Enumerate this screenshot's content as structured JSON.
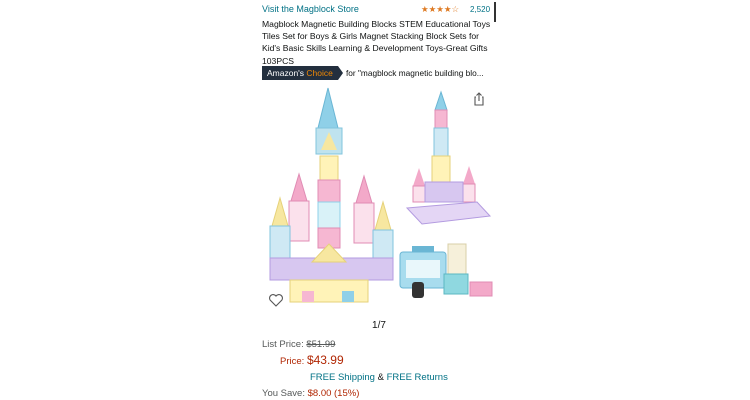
{
  "store": {
    "link": "Visit the Magblock Store",
    "stars_glyph": "★★★★☆",
    "rating_value": 4.5,
    "rating_count": "2,520"
  },
  "product": {
    "title": "Magblock Magnetic Building Blocks STEM Educational Toys Tiles Set for Boys & Girls Magnet Stacking Block Sets for Kid's Basic Skills Learning & Development Toys-Great Gifts 103PCS"
  },
  "badge": {
    "brand": "Amazon's ",
    "choice": "Choice",
    "for_text": "for \"magblock magnetic building blo..."
  },
  "gallery": {
    "pager": "1/7"
  },
  "pricing": {
    "list_label": "List Price:",
    "list_value": "$51.99",
    "price_label": "Price:",
    "price_value": "$43.99",
    "free_shipping": "FREE Shipping",
    "amp": " & ",
    "free_returns": "FREE Returns",
    "save_label": "You Save:",
    "save_value": "$8.00 (15%)"
  },
  "colors": {
    "link": "#007185",
    "price": "#b12704",
    "badge_bg": "#232f3e",
    "badge_choice": "#f08804",
    "star": "#de7921"
  },
  "icons": {
    "share": "share-icon",
    "wishlist": "heart-icon"
  }
}
